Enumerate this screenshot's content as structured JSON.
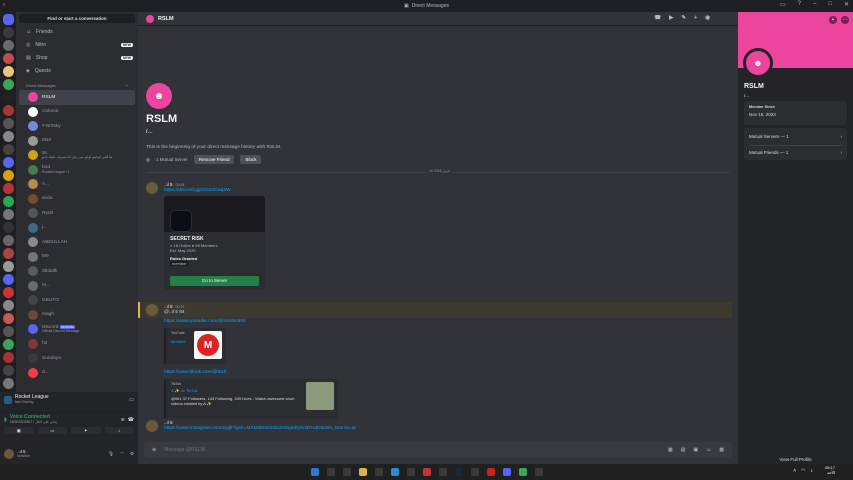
{
  "window": {
    "title": "Direct Messages"
  },
  "sidebar": {
    "search_label": "Find or start a conversation",
    "nav": [
      {
        "label": "Friends",
        "icon": "friends-icon"
      },
      {
        "label": "Nitro",
        "icon": "nitro-icon",
        "badge": "NEW"
      },
      {
        "label": "Shop",
        "icon": "shop-icon",
        "badge": "NEW"
      },
      {
        "label": "Quests",
        "icon": "quests-icon"
      }
    ],
    "dm_header": "Direct Messages",
    "dms": [
      {
        "name": "RSLM",
        "active": true,
        "color": "#eb459e"
      },
      {
        "name": "Colonia",
        "color": "#ffffff"
      },
      {
        "name": "# Br0sky",
        "color": "#7289da"
      },
      {
        "name": "M10",
        "color": "#9a9a9a"
      },
      {
        "name": "SL",
        "sub": "ها قلبي اوجيتو اوجع بس رغي انا صبرتف عليك جدو",
        "color": "#d4a017"
      },
      {
        "name": "bod",
        "sub": "Rocket League +1",
        "color": "#4a7a4a"
      },
      {
        "name": "A...",
        "color": "#b58b4f"
      },
      {
        "name": "sedo",
        "color": "#7a4a2a"
      },
      {
        "name": "Ryolt",
        "color": "#555555"
      },
      {
        "name": "j...",
        "color": "#3a6a8a"
      },
      {
        "name": "ABDULLAH",
        "color": "#8a8a8a"
      },
      {
        "name": "M9",
        "color": "#777777"
      },
      {
        "name": "3bdallh",
        "color": "#5a5a5a"
      },
      {
        "name": "m...",
        "color": "#6a6a6a"
      },
      {
        "name": "GEUTO",
        "color": "#444444"
      },
      {
        "name": "magh",
        "color": "#6a4a3a"
      },
      {
        "name": "Discord",
        "sub": "Official Discord Message",
        "tag": "OFFICIAL",
        "color": "#5865f2"
      },
      {
        "name": "h2",
        "color": "#7a3a3a"
      },
      {
        "name": "Sundaya",
        "color": "#3a3a3a"
      },
      {
        "name": "d...",
        "color": "#f23f43"
      }
    ]
  },
  "activity": {
    "title": "Rocket League",
    "sub": "Not Sharing"
  },
  "voice": {
    "status": "Voice Connected",
    "sub": "ينادي على الكل / 8302607 0806"
  },
  "user": {
    "name": "..ıl 5",
    "status": "Invisible"
  },
  "chat": {
    "header_name": "RSLM",
    "intro_name": "RSLM",
    "intro_sub": "r...",
    "intro_text": "This is the beginning of your direct message history with RSLM.",
    "mutual": "1 Mutual Server",
    "remove_friend": "Remove Friend",
    "block": "Block",
    "date_divider": "10 ابريل 2025",
    "composer_placeholder": "Message @RSLM",
    "messages": [
      {
        "author": "..ıl 5",
        "time": "00:05",
        "link": "https://discord.gg/2m22Cwq3W",
        "invite": {
          "server": "SECRET RISK",
          "online": "18 Online",
          "members": "66 Members",
          "est": "Est. May 2020",
          "roles": "Roles Granted",
          "role": "member",
          "button": "Go to Server"
        }
      },
      {
        "author": "..ıl 5",
        "time": "00:19",
        "mention": "@..ıl 5 84",
        "link1": "https://www.youtube.com/@mmllm584",
        "yt_title": "YouTube",
        "yt_channel": "Mm5m5",
        "link2": "https://www.tiktok.com/@0i1tl",
        "tt_site": "TikTok",
        "tt_title": "A ✨ on TikTok",
        "tt_desc": "@0it1 37 Followers, 143 Following, 339 Likes - Watch awesome short videos created by A ✨"
      },
      {
        "author": "..ıl 5",
        "link": "https://www.instagram.com/zygll?igsh=MXM4b0t2ZGk2NXg4dQ%3D%3D&utm_source=qr"
      }
    ]
  },
  "profile": {
    "name": "RSLM",
    "sub": "r...",
    "member_since_label": "Member Since",
    "member_since": "Nov 16, 2023",
    "mutual_servers": "Mutual Servers — 1",
    "mutual_friends": "Mutual Friends — 1",
    "view_full": "View Full Profile"
  },
  "taskbar": {
    "time": "05:17",
    "date": "الأحد"
  },
  "colors": {
    "accent": "#5865f2",
    "pink": "#eb459e",
    "green": "#248046",
    "link": "#00a8fc"
  }
}
